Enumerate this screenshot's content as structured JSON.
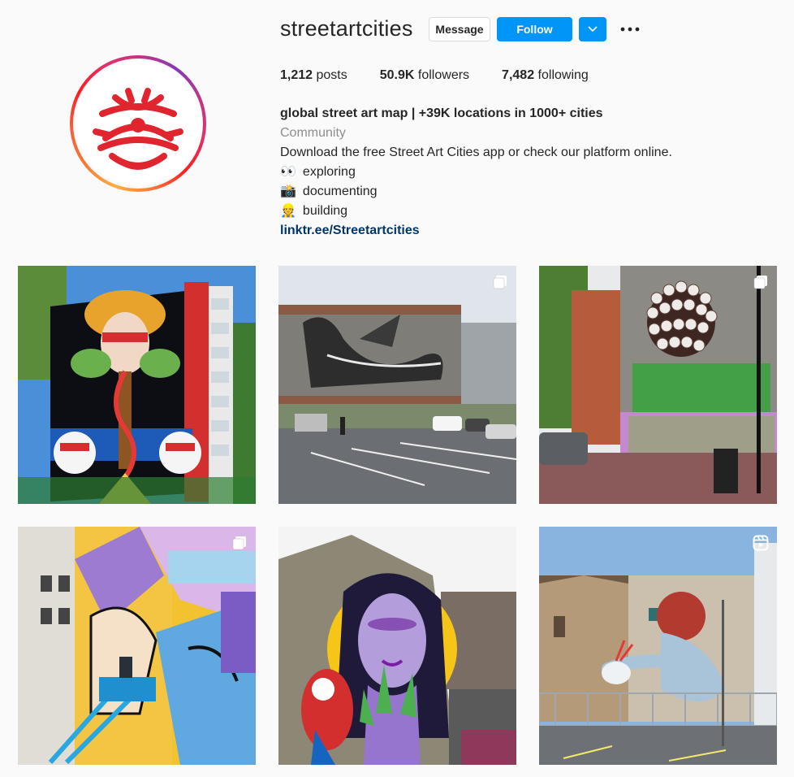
{
  "profile": {
    "username": "streetartcities",
    "message_label": "Message",
    "follow_label": "Follow"
  },
  "stats": {
    "posts_count": "1,212",
    "posts_label": "posts",
    "followers_count": "50.9K",
    "followers_label": "followers",
    "following_count": "7,482",
    "following_label": "following"
  },
  "bio": {
    "title": "global street art map | +39K locations in 1000+ cities",
    "category": "Community",
    "description": "Download the free Street Art Cities app or check our platform online.",
    "lines": [
      {
        "emoji": "👀",
        "text": "exploring"
      },
      {
        "emoji": "📸",
        "text": "documenting"
      },
      {
        "emoji": "👷",
        "text": "building"
      }
    ],
    "link": "linktr.ee/Streetartcities"
  },
  "grid": {
    "posts": [
      {
        "badge": "none"
      },
      {
        "badge": "carousel-icon"
      },
      {
        "badge": "carousel-icon"
      },
      {
        "badge": "carousel-icon"
      },
      {
        "badge": "none"
      },
      {
        "badge": "reel-icon"
      }
    ]
  },
  "colors": {
    "accent": "#0095f6",
    "logo_red": "#e0252f",
    "link": "#00376b",
    "muted": "#8e8e8e"
  }
}
